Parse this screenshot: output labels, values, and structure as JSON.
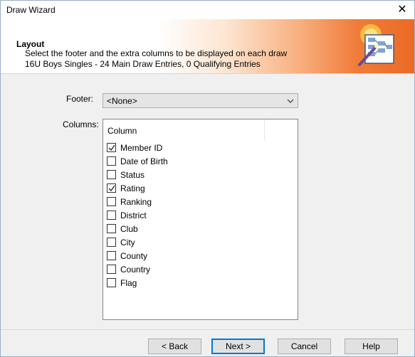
{
  "window": {
    "title": "Draw Wizard",
    "close_glyph": "✕"
  },
  "header": {
    "title": "Layout",
    "line1": "Select the footer and the extra columns to be displayed on each draw",
    "line2": "16U Boys Singles - 24 Main Draw Entries, 0 Qualifying Entries",
    "icon": "wizard-icon",
    "gradient_end_color": "#ec6a26"
  },
  "form": {
    "footer_label": "Footer:",
    "footer_value": "<None>",
    "columns_label": "Columns:",
    "columns_header": "Column",
    "columns": [
      {
        "label": "Member ID",
        "checked": true
      },
      {
        "label": "Date of Birth",
        "checked": false
      },
      {
        "label": "Status",
        "checked": false
      },
      {
        "label": "Rating",
        "checked": true
      },
      {
        "label": "Ranking",
        "checked": false
      },
      {
        "label": "District",
        "checked": false
      },
      {
        "label": "Club",
        "checked": false
      },
      {
        "label": "City",
        "checked": false
      },
      {
        "label": "County",
        "checked": false
      },
      {
        "label": "Country",
        "checked": false
      },
      {
        "label": "Flag",
        "checked": false
      }
    ]
  },
  "buttons": {
    "back": "< Back",
    "next": "Next >",
    "cancel": "Cancel",
    "help": "Help"
  }
}
